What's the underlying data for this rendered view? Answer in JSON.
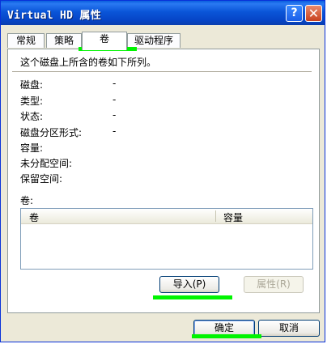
{
  "window": {
    "title": "Virtual HD 属性",
    "help_label": "?",
    "close_label": "✕"
  },
  "tabs": [
    {
      "label": "常规",
      "active": false
    },
    {
      "label": "策略",
      "active": false
    },
    {
      "label": "卷",
      "active": true
    },
    {
      "label": "驱动程序",
      "active": false
    }
  ],
  "volume_tab": {
    "description": "这个磁盘上所含的卷如下所列。",
    "fields": [
      {
        "label": "磁盘:",
        "value": "-"
      },
      {
        "label": "类型:",
        "value": "-"
      },
      {
        "label": "状态:",
        "value": "-"
      },
      {
        "label": "磁盘分区形式:",
        "value": "-"
      },
      {
        "label": "容量:",
        "value": ""
      },
      {
        "label": "未分配空间:",
        "value": ""
      },
      {
        "label": "保留空间:",
        "value": ""
      }
    ],
    "volumes_label": "卷:",
    "columns": [
      "卷",
      "容量"
    ],
    "rows": [],
    "import_button": "导入(P)",
    "properties_button": "属性(R)"
  },
  "footer": {
    "ok_button": "确定",
    "cancel_button": "取消"
  },
  "colors": {
    "title_bar": "#0a55d8",
    "highlight": "#00f400"
  }
}
